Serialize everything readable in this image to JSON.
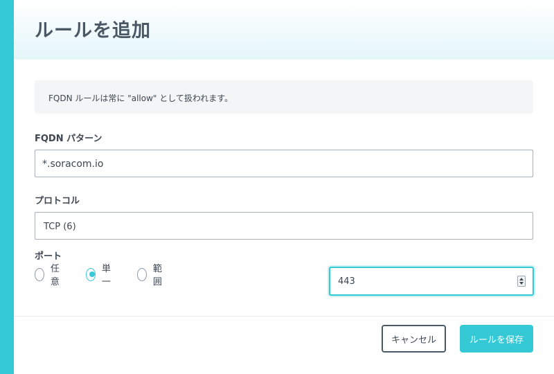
{
  "dialog": {
    "title": "ルールを追加"
  },
  "info": {
    "text": "FQDN ルールは常に \"allow\" として扱われます。"
  },
  "fqdn": {
    "label": "FQDN パターン",
    "value": "*.soracom.io"
  },
  "protocol": {
    "label": "プロトコル",
    "value": "TCP (6)"
  },
  "port": {
    "label": "ポート",
    "options": [
      {
        "label": "任意",
        "checked": false
      },
      {
        "label": "単一",
        "checked": true
      },
      {
        "label": "範囲",
        "checked": false
      }
    ],
    "value": "443"
  },
  "buttons": {
    "cancel": "キャンセル",
    "save": "ルールを保存"
  },
  "colors": {
    "accent": "#35c9d6",
    "text": "#3d4651",
    "title": "#4a5866"
  }
}
